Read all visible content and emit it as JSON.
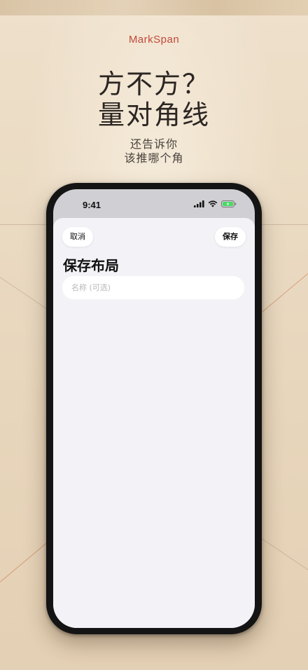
{
  "promo": {
    "brand": "MarkSpan",
    "headline_line1": "方不方？",
    "headline_line2": "量对角线",
    "subline_line1": "还告诉你",
    "subline_line2": "该推哪个角"
  },
  "status_bar": {
    "time": "9:41",
    "icons": [
      "cellular-signal-icon",
      "wifi-icon",
      "battery-charging-icon"
    ],
    "battery_color": "#4cd964"
  },
  "sheet": {
    "cancel_label": "取消",
    "save_label": "保存",
    "title": "保存布局",
    "name_field": {
      "value": "",
      "placeholder": "名称 (可选)"
    }
  },
  "colors": {
    "brand": "#c2483a",
    "sheet_background": "#f2f2f7",
    "paper": "#eadbc5"
  }
}
